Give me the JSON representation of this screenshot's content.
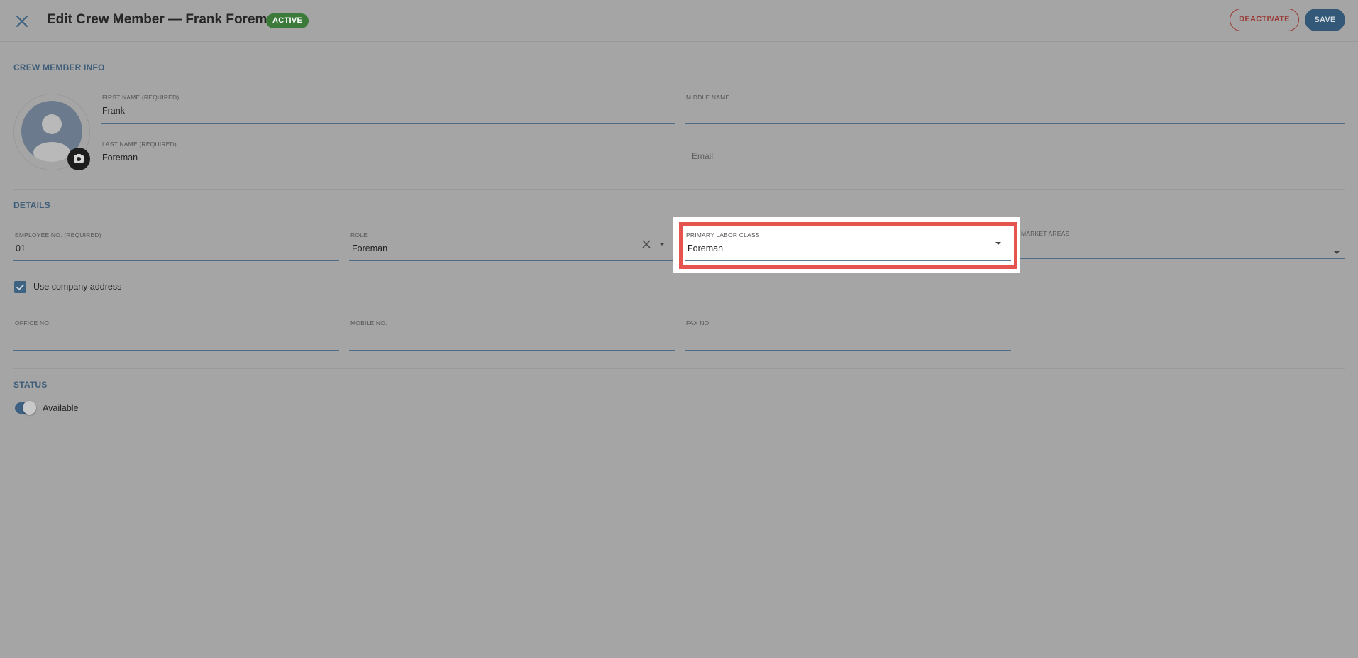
{
  "header": {
    "title": "Edit Crew Member — Frank Foreman",
    "status_badge": "ACTIVE",
    "deactivate_label": "DEACTIVATE",
    "save_label": "SAVE"
  },
  "crew_info": {
    "section_title": "CREW MEMBER INFO",
    "first_name": {
      "label": "FIRST NAME (REQUIRED)",
      "value": "Frank"
    },
    "middle_name": {
      "label": "MIDDLE NAME",
      "value": ""
    },
    "last_name": {
      "label": "LAST NAME (REQUIRED)",
      "value": "Foreman"
    },
    "email": {
      "placeholder": "Email",
      "value": ""
    }
  },
  "details": {
    "section_title": "DETAILS",
    "employee_no": {
      "label": "EMPLOYEE NO. (REQUIRED)",
      "value": "01"
    },
    "role": {
      "label": "ROLE",
      "value": "Foreman"
    },
    "primary_labor_class": {
      "label": "PRIMARY LABOR CLASS",
      "value": "Foreman"
    },
    "market_areas": {
      "label": "MARKET AREAS",
      "value": ""
    },
    "use_company_address": {
      "label": "Use company address",
      "checked": true
    },
    "office_no": {
      "label": "OFFICE NO.",
      "value": ""
    },
    "mobile_no": {
      "label": "MOBILE NO.",
      "value": ""
    },
    "fax_no": {
      "label": "FAX NO.",
      "value": ""
    }
  },
  "status": {
    "section_title": "STATUS",
    "available": {
      "label": "Available",
      "on": true
    }
  },
  "colors": {
    "accent": "#3e6282",
    "badge_green": "#3b7a3a",
    "deactivate_red": "#9a3a36",
    "highlight_red": "#e5544e"
  },
  "icons": [
    "close-icon",
    "camera-icon",
    "person-icon",
    "clear-icon",
    "dropdown-arrow-icon",
    "check-icon"
  ]
}
